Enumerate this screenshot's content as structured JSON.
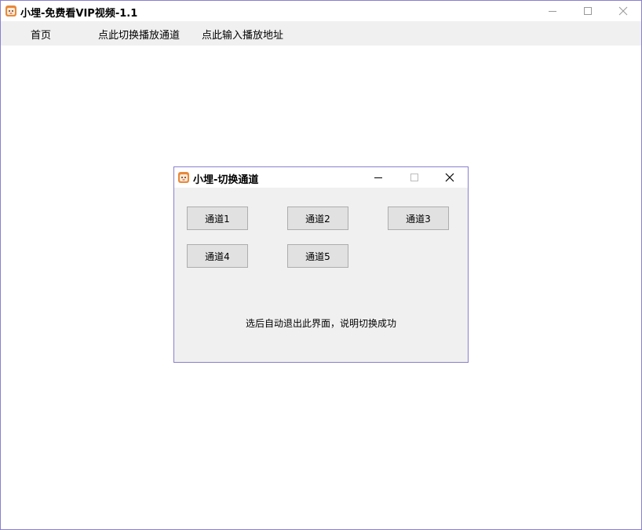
{
  "window": {
    "title": "小埋-免费看VIP视频-1.1"
  },
  "menubar": {
    "items": [
      {
        "label": "首页"
      },
      {
        "label": "点此切换播放通道"
      },
      {
        "label": "点此输入播放地址"
      }
    ]
  },
  "dialog": {
    "title": "小埋-切换通道",
    "buttons": [
      {
        "label": "通道1"
      },
      {
        "label": "通道2"
      },
      {
        "label": "通道3"
      },
      {
        "label": "通道4"
      },
      {
        "label": "通道5"
      }
    ],
    "hint": "选后自动退出此界面，说明切换成功"
  },
  "icons": {
    "app": "umaru-app-icon",
    "minimize": "minimize-icon",
    "maximize": "maximize-icon",
    "close": "close-icon"
  },
  "colors": {
    "frame_border": "#8a7fd0",
    "menubar_bg": "#f0f0f0",
    "button_bg": "#e1e1e1",
    "icon_orange": "#e8893a"
  }
}
